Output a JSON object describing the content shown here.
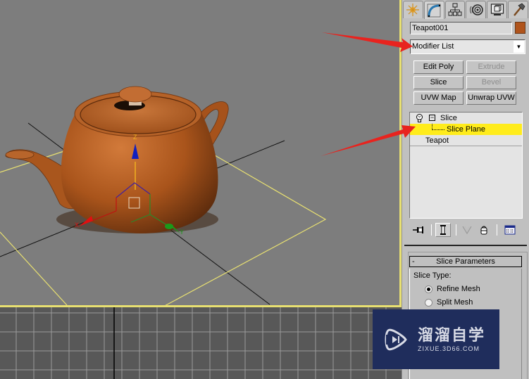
{
  "command_panel": {
    "tabs": [
      {
        "name": "create",
        "icon": "create-icon",
        "active": false
      },
      {
        "name": "modify",
        "icon": "modify-icon",
        "active": true
      },
      {
        "name": "hierarchy",
        "icon": "hierarchy-icon",
        "active": false
      },
      {
        "name": "motion",
        "icon": "motion-icon",
        "active": false
      },
      {
        "name": "display",
        "icon": "display-icon",
        "active": false
      },
      {
        "name": "utilities",
        "icon": "utilities-icon",
        "active": false
      }
    ],
    "object_name": "Teapot001",
    "object_color": "#b0541c",
    "modifier_list": "Modifier List",
    "modifier_buttons": [
      {
        "label": "Edit Poly",
        "enabled": true
      },
      {
        "label": "Extrude",
        "enabled": false
      },
      {
        "label": "Slice",
        "enabled": true
      },
      {
        "label": "Bevel",
        "enabled": false
      },
      {
        "label": "UVW Map",
        "enabled": true
      },
      {
        "label": "Unwrap UVW",
        "enabled": true
      }
    ],
    "modifier_stack": [
      {
        "label": "Slice",
        "type": "modifier",
        "expanded": true
      },
      {
        "label": "Slice Plane",
        "type": "sub-object",
        "selected": true
      },
      {
        "label": "Teapot",
        "type": "base-object"
      }
    ],
    "stack_toolbar": [
      "pin-stack-icon",
      "show-end-result-icon",
      "make-unique-icon",
      "remove-modifier-icon",
      "configure-modifier-sets-icon"
    ],
    "rollout": {
      "title": "Slice Parameters",
      "collapse_symbol": "-",
      "slice_type_label": "Slice Type:",
      "options": [
        {
          "label": "Refine Mesh",
          "checked": true
        },
        {
          "label": "Split Mesh",
          "checked": false
        }
      ]
    }
  },
  "viewport": {
    "object": "Teapot",
    "gizmo_axes": {
      "x": "X",
      "y": "Y",
      "z": "Z"
    },
    "colors": {
      "selection": "#e8e071",
      "teapot": "#b0541c",
      "x_axis": "#e01010",
      "y_axis": "#1a9a1a",
      "z_axis": "#1020c0",
      "z_label": "#f0b020"
    }
  },
  "watermark": {
    "title": "溜溜自学",
    "url": "ZIXUE.3D66.COM"
  },
  "annotations": {
    "arrow_color": "#e8231e",
    "targets": [
      "modifier-list",
      "slice-plane"
    ]
  }
}
